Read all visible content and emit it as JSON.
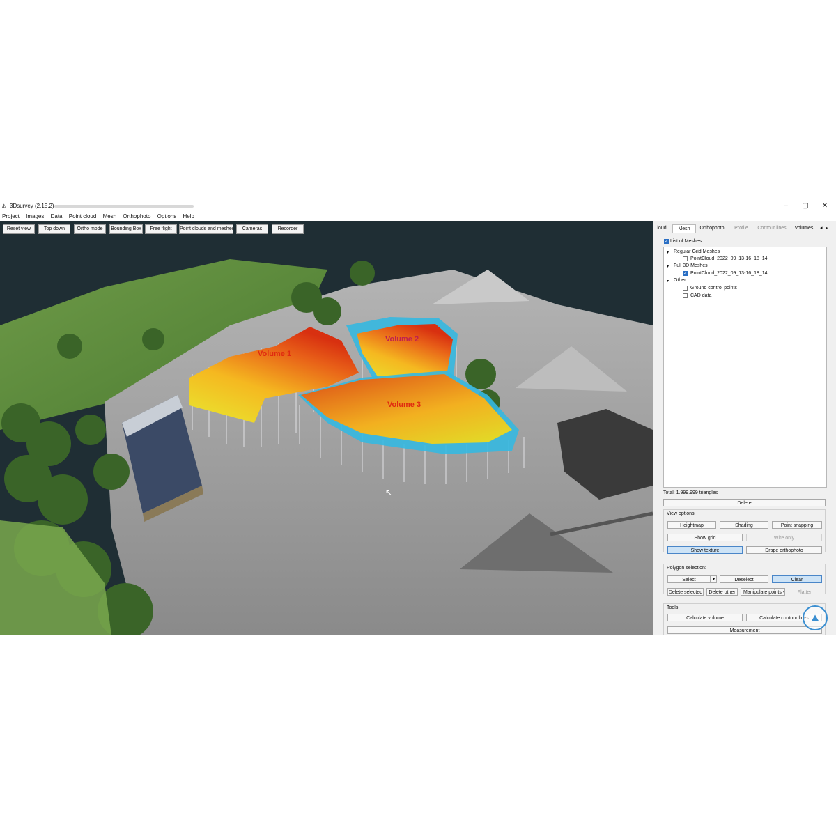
{
  "window": {
    "title": "3Dsurvey (2.15.2) -",
    "minimize": "–",
    "maximize": "▢",
    "close": "✕"
  },
  "menu": [
    "Project",
    "Images",
    "Data",
    "Point cloud",
    "Mesh",
    "Orthophoto",
    "Options",
    "Help"
  ],
  "viewport_toolbar": [
    "Reset view",
    "Top down",
    "Ortho mode",
    "Bounding Box",
    "Free flight",
    "Point clouds and meshes",
    "Cameras",
    "Recorder"
  ],
  "volumes": [
    "Volume 1",
    "Volume 2",
    "Volume 3"
  ],
  "panel": {
    "tabs": [
      {
        "label": "loud",
        "state": "normal"
      },
      {
        "label": "Mesh",
        "state": "active"
      },
      {
        "label": "Orthophoto",
        "state": "normal"
      },
      {
        "label": "Profile",
        "state": "disabled"
      },
      {
        "label": "Contour lines",
        "state": "disabled"
      },
      {
        "label": "Volumes",
        "state": "normal"
      }
    ],
    "list_label": "List of Meshes:",
    "tree": {
      "regular": "Regular Grid Meshes",
      "regular_item": "PointCloud_2022_09_13-16_18_14",
      "full": "Full 3D Meshes",
      "full_item": "PointCloud_2022_09_13-16_18_14",
      "other": "Other",
      "gcp": "Ground control points",
      "cad": "CAD data"
    },
    "total": "Total: 1.999.999 triangles",
    "delete": "Delete",
    "view_options_label": "View options:",
    "view_buttons": {
      "heightmap": "Heightmap",
      "shading": "Shading",
      "point_snapping": "Point snapping",
      "show_grid": "Show grid",
      "wire_only": "Wire only",
      "show_texture": "Show texture",
      "drape_orthophoto": "Drape orthophoto"
    },
    "polygon_label": "Polygon selection:",
    "polygon_buttons": {
      "select": "Select",
      "deselect": "Deselect",
      "clear": "Clear",
      "delete_selected": "Delete selected",
      "delete_other": "Delete other",
      "manipulate_points": "Manipulate points",
      "flatten": "Flatten"
    },
    "tools_label": "Tools:",
    "tools_buttons": {
      "calculate_volume": "Calculate volume",
      "calculate_contour": "Calculate contour lines",
      "measurement": "Measurement"
    }
  },
  "colors": {
    "accent": "#2a6fc4",
    "water": "#1f2e34",
    "heat_low": "#f0e020",
    "heat_high": "#e04010",
    "base_cyan": "#35b8e0"
  }
}
